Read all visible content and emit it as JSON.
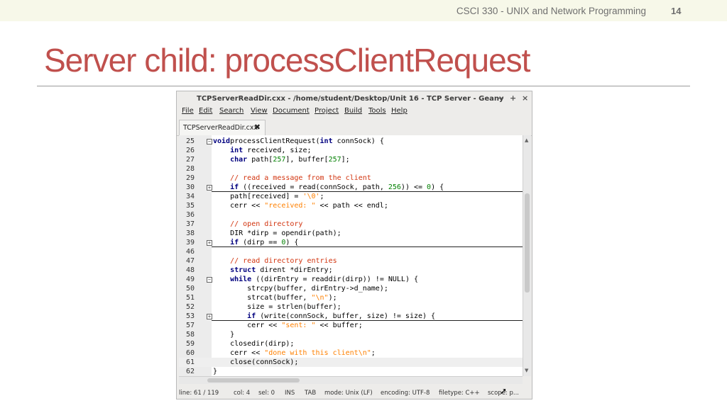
{
  "slide": {
    "course": "CSCI 330 - UNIX and Network Programming",
    "page_number": "14",
    "title": "Server child: processClientRequest"
  },
  "window": {
    "title": "TCPServerReadDir.cxx - /home/student/Desktop/Unit 16 - TCP Server - Geany",
    "controls": [
      "−",
      "+",
      "×"
    ],
    "menu": [
      "File",
      "Edit",
      "Search",
      "View",
      "Document",
      "Project",
      "Build",
      "Tools",
      "Help"
    ],
    "tab": {
      "label": "TCPServerReadDir.cxx",
      "close": "✖"
    },
    "code": [
      {
        "ln": "25",
        "fold": "minus",
        "tokens": [
          [
            "kw",
            "void"
          ],
          [
            "",
            "processClientRequest("
          ],
          [
            "kw",
            "int"
          ],
          [
            "",
            " connSock) {"
          ]
        ]
      },
      {
        "ln": "26",
        "tokens": [
          [
            "",
            "    "
          ],
          [
            "kw",
            "int"
          ],
          [
            "",
            " received, size;"
          ]
        ]
      },
      {
        "ln": "27",
        "tokens": [
          [
            "",
            "    "
          ],
          [
            "kw",
            "char"
          ],
          [
            "",
            " path["
          ],
          [
            "nm",
            "257"
          ],
          [
            "",
            "], buffer["
          ],
          [
            "nm",
            "257"
          ],
          [
            "",
            "];"
          ]
        ]
      },
      {
        "ln": "28",
        "tokens": []
      },
      {
        "ln": "29",
        "tokens": [
          [
            "",
            "    "
          ],
          [
            "cm",
            "// read a message from the client"
          ]
        ]
      },
      {
        "ln": "30",
        "fold": "plus",
        "tokens": [
          [
            "",
            "    "
          ],
          [
            "kw",
            "if"
          ],
          [
            "",
            " ((received = read(connSock, path, "
          ],
          [
            "nm",
            "256"
          ],
          [
            "",
            ")) <= "
          ],
          [
            "nm",
            "0"
          ],
          [
            "",
            ") {"
          ]
        ]
      },
      {
        "ln": "34",
        "tokens": [
          [
            "",
            "    path[received] = "
          ],
          [
            "st",
            "'\\0'"
          ],
          [
            "",
            ";"
          ]
        ]
      },
      {
        "ln": "35",
        "tokens": [
          [
            "",
            "    cerr << "
          ],
          [
            "st",
            "\"received: \""
          ],
          [
            "",
            " << path << endl;"
          ]
        ]
      },
      {
        "ln": "36",
        "tokens": []
      },
      {
        "ln": "37",
        "tokens": [
          [
            "",
            "    "
          ],
          [
            "cm",
            "// open directory"
          ]
        ]
      },
      {
        "ln": "38",
        "tokens": [
          [
            "",
            "    DIR *dirp = opendir(path);"
          ]
        ]
      },
      {
        "ln": "39",
        "fold": "plus",
        "tokens": [
          [
            "",
            "    "
          ],
          [
            "kw",
            "if"
          ],
          [
            "",
            " (dirp == "
          ],
          [
            "nm",
            "0"
          ],
          [
            "",
            ") {"
          ]
        ]
      },
      {
        "ln": "46",
        "tokens": []
      },
      {
        "ln": "47",
        "tokens": [
          [
            "",
            "    "
          ],
          [
            "cm",
            "// read directory entries"
          ]
        ]
      },
      {
        "ln": "48",
        "tokens": [
          [
            "",
            "    "
          ],
          [
            "kw",
            "struct"
          ],
          [
            "",
            " dirent *dirEntry;"
          ]
        ]
      },
      {
        "ln": "49",
        "fold": "minus",
        "tokens": [
          [
            "",
            "    "
          ],
          [
            "kw",
            "while"
          ],
          [
            "",
            " ((dirEntry = readdir(dirp)) != NULL) {"
          ]
        ]
      },
      {
        "ln": "50",
        "tokens": [
          [
            "",
            "        strcpy(buffer, dirEntry->d_name);"
          ]
        ]
      },
      {
        "ln": "51",
        "tokens": [
          [
            "",
            "        strcat(buffer, "
          ],
          [
            "st",
            "\"\\n\""
          ],
          [
            "",
            ");"
          ]
        ]
      },
      {
        "ln": "52",
        "tokens": [
          [
            "",
            "        size = strlen(buffer);"
          ]
        ]
      },
      {
        "ln": "53",
        "fold": "plus",
        "tokens": [
          [
            "",
            "        "
          ],
          [
            "kw",
            "if"
          ],
          [
            "",
            " (write(connSock, buffer, size) != size) {"
          ]
        ]
      },
      {
        "ln": "57",
        "tokens": [
          [
            "",
            "        cerr << "
          ],
          [
            "st",
            "\"sent: \""
          ],
          [
            "",
            " << buffer;"
          ]
        ]
      },
      {
        "ln": "58",
        "tokens": [
          [
            "",
            "    }"
          ]
        ]
      },
      {
        "ln": "59",
        "tokens": [
          [
            "",
            "    closedir(dirp);"
          ]
        ]
      },
      {
        "ln": "60",
        "tokens": [
          [
            "",
            "    cerr << "
          ],
          [
            "st",
            "\"done with this client\\n\""
          ],
          [
            "",
            ";"
          ]
        ]
      },
      {
        "ln": "61",
        "current": true,
        "tokens": [
          [
            "",
            "    close(connSock);"
          ]
        ]
      },
      {
        "ln": "62",
        "tokens": [
          [
            "",
            "}"
          ]
        ]
      }
    ],
    "status": [
      "line: 61 / 119",
      "col: 4",
      "sel: 0",
      "INS",
      "TAB",
      "mode: Unix (LF)",
      "encoding: UTF-8",
      "filetype: C++",
      "scope: p..."
    ]
  }
}
